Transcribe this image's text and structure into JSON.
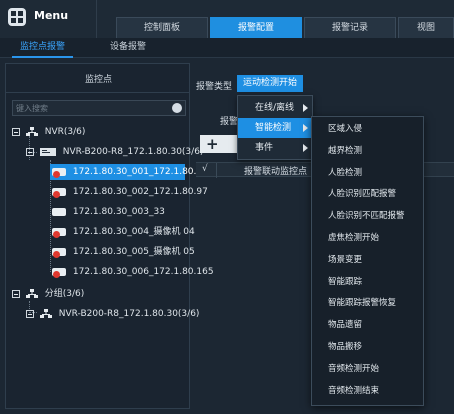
{
  "app": {
    "menu_label": "Menu"
  },
  "tabs": [
    {
      "label": "控制面板",
      "active": false
    },
    {
      "label": "报警配置",
      "active": true
    },
    {
      "label": "报警记录",
      "active": false
    },
    {
      "label": "视图",
      "active": false
    }
  ],
  "subtabs": [
    {
      "label": "监控点报警",
      "active": true
    },
    {
      "label": "设备报警",
      "active": false
    }
  ],
  "left_panel": {
    "title": "监控点",
    "search_placeholder": "键入搜索",
    "tree": {
      "nvr_root": "NVR(3/6)",
      "device": "NVR-B200-R8_172.1.80.30(3/6)",
      "cameras": [
        {
          "label": "172.1.80.30_001_172.1.80.42",
          "selected": true,
          "error": true
        },
        {
          "label": "172.1.80.30_002_172.1.80.97",
          "selected": false,
          "error": true
        },
        {
          "label": "172.1.80.30_003_33",
          "selected": false,
          "error": false
        },
        {
          "label": "172.1.80.30_004_摄像机 04",
          "selected": false,
          "error": true
        },
        {
          "label": "172.1.80.30_005_摄像机 05",
          "selected": false,
          "error": true
        },
        {
          "label": "172.1.80.30_006_172.1.80.165",
          "selected": false,
          "error": true
        }
      ],
      "group_root": "分组(3/6)",
      "group_device": "NVR-B200-R8_172.1.80.30(3/6)"
    }
  },
  "right_panel": {
    "alarm_type_label": "报警类型",
    "alarm_type_value": "运动检测开始",
    "ghost_label": "报警",
    "table_headers": {
      "check": "√",
      "col1": "报警联动监控点"
    }
  },
  "menu_level1": [
    {
      "label": "在线/离线",
      "active": false,
      "has_submenu": true
    },
    {
      "label": "智能检测",
      "active": true,
      "has_submenu": true
    },
    {
      "label": "事件",
      "active": false,
      "has_submenu": true
    }
  ],
  "menu_level2": [
    "区域入侵",
    "越界检测",
    "人脸检测",
    "人脸识别匹配报警",
    "人脸识别不匹配报警",
    "虚焦检测开始",
    "场景变更",
    "智能跟踪",
    "智能跟踪报警恢复",
    "物品遗留",
    "物品搬移",
    "音频检测开始",
    "音频检测结束"
  ],
  "colors": {
    "accent": "#1e8fe3",
    "background": "#1c2733",
    "error": "#e0382f"
  },
  "icons": {
    "menu": "menu-grid-icon",
    "search": "search-icon",
    "camera": "camera-icon",
    "nvr": "nvr-device-icon",
    "network": "network-tree-icon"
  }
}
